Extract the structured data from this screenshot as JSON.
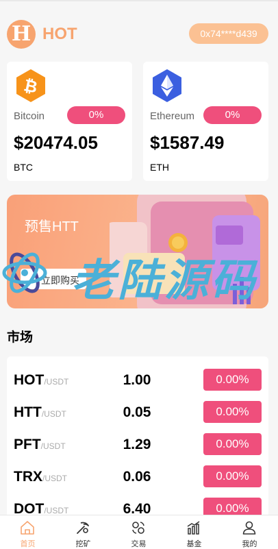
{
  "header": {
    "logo_letter": "H",
    "logo_text": "HOT",
    "address": "0x74****d439"
  },
  "coins": [
    {
      "name": "Bitcoin",
      "change": "0%",
      "price": "$20474.05",
      "symbol": "BTC",
      "icon": "bitcoin-icon",
      "color": "#f7931a"
    },
    {
      "name": "Ethereum",
      "change": "0%",
      "price": "$1587.49",
      "symbol": "ETH",
      "icon": "ethereum-icon",
      "color": "#3b5fe0"
    }
  ],
  "banner": {
    "title": "预售HTT",
    "button": "立即购买"
  },
  "watermark": "老陆源码",
  "market": {
    "title": "市场",
    "rows": [
      {
        "base": "HOT",
        "quote": "/USDT",
        "price": "1.00",
        "change": "0.00%"
      },
      {
        "base": "HTT",
        "quote": "/USDT",
        "price": "0.05",
        "change": "0.00%"
      },
      {
        "base": "PFT",
        "quote": "/USDT",
        "price": "1.29",
        "change": "0.00%"
      },
      {
        "base": "TRX",
        "quote": "/USDT",
        "price": "0.06",
        "change": "0.00%"
      },
      {
        "base": "DOT",
        "quote": "/USDT",
        "price": "6.40",
        "change": "0.00%"
      }
    ]
  },
  "tabs": [
    {
      "label": "首页",
      "icon": "home-icon",
      "active": true
    },
    {
      "label": "挖矿",
      "icon": "mining-icon",
      "active": false
    },
    {
      "label": "交易",
      "icon": "trade-icon",
      "active": false
    },
    {
      "label": "基金",
      "icon": "fund-icon",
      "active": false
    },
    {
      "label": "我的",
      "icon": "profile-icon",
      "active": false
    }
  ],
  "colors": {
    "accent": "#f7a46f",
    "change_badge": "#ef4f7c"
  }
}
